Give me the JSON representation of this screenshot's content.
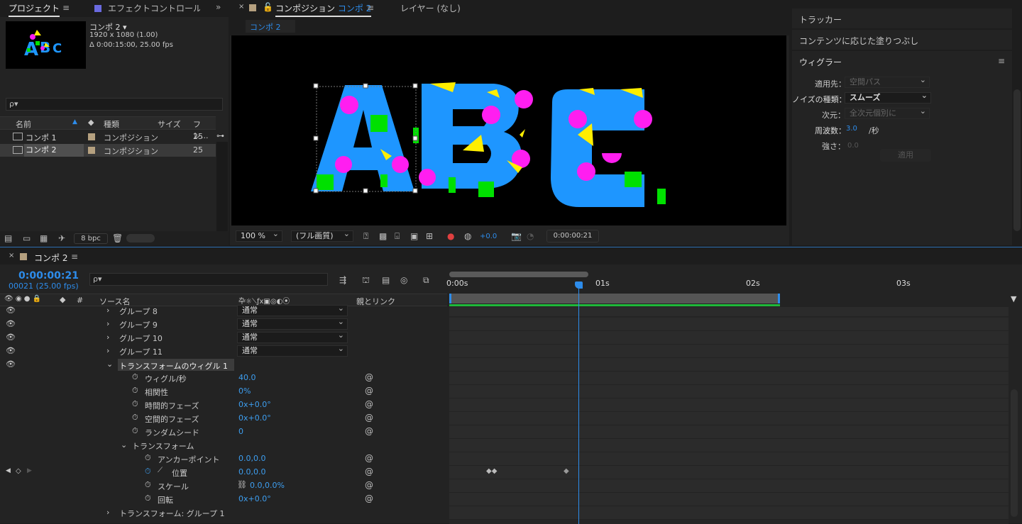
{
  "project": {
    "tab": "プロジェクト",
    "tab2": "エフェクトコントロール A",
    "comp_name": "コンポ 2 ▾",
    "res": "1920 x 1080 (1.00)",
    "dur": "Δ 0:00:15:00, 25.00 fps",
    "search_placeholder": "ρ▾",
    "headers": {
      "name": "名前",
      "type": "種類",
      "size": "サイズ",
      "frame": "フレ..."
    },
    "items": [
      {
        "name": "コンポ 1",
        "type": "コンポジション",
        "frame": "25"
      },
      {
        "name": "コンポ 2",
        "type": "コンポジション",
        "frame": "25"
      }
    ],
    "bpc": "8 bpc"
  },
  "comp": {
    "tab": "コンポジション",
    "tab_comp": "コンポ 2",
    "layer_tab": "レイヤー (なし)",
    "subtab": "コンポ 2",
    "zoom": "100 %",
    "quality": "(フル画質)",
    "exposure": "+0.0",
    "timecode": "0:00:00:21",
    "letters": "ABC"
  },
  "right": {
    "items": [
      "トラッカー",
      "コンテンツに応じた塗りつぶし"
    ],
    "wiggler_title": "ウィグラー",
    "apply_to_label": "適用先：",
    "apply_to": "空間パス",
    "noise_label": "ノイズの種類：",
    "noise": "スムーズ",
    "dim_label": "次元：",
    "dim": "全次元個別に",
    "freq_label": "周波数：",
    "freq": "3.0",
    "freq_unit": "/秒",
    "mag_label": "強さ：",
    "mag": "0.0",
    "apply_btn": "適用"
  },
  "timeline": {
    "tab": "コンポ 2",
    "timecode": "0:00:00:21",
    "frame": "00021 (25.00 fps)",
    "search_placeholder": "ρ▾",
    "col_source": "ソース名",
    "col_parent": "親とリンク",
    "col_hash": "#",
    "ruler": [
      "0:00s",
      "01s",
      "02s",
      "03s"
    ],
    "layers": [
      {
        "name": "グループ 8",
        "mode": "通常"
      },
      {
        "name": "グループ 9",
        "mode": "通常"
      },
      {
        "name": "グループ 10",
        "mode": "通常"
      },
      {
        "name": "グループ 11",
        "mode": "通常"
      }
    ],
    "effect": "トランスフォームのウィグル 1",
    "props": [
      {
        "name": "ウィグル/秒",
        "value": "40.0"
      },
      {
        "name": "相関性",
        "value": "0%"
      },
      {
        "name": "時間的フェーズ",
        "value": "0x+0.0°"
      },
      {
        "name": "空間的フェーズ",
        "value": "0x+0.0°"
      },
      {
        "name": "ランダムシード",
        "value": "0"
      }
    ],
    "transform": "トランスフォーム",
    "tprops": [
      {
        "name": "アンカーポイント",
        "value": "0.0,0.0"
      },
      {
        "name": "位置",
        "value": "0.0,0.0"
      },
      {
        "name": "スケール",
        "value": "0.0,0.0%"
      },
      {
        "name": "回転",
        "value": "0x+0.0°"
      }
    ],
    "last": "トランスフォーム: グループ 1"
  },
  "colors": {
    "accent": "#2d8ceb",
    "letter": "#1e96ff",
    "magenta": "#ff1ef0",
    "yellow": "#ffee00",
    "green": "#00e000"
  }
}
